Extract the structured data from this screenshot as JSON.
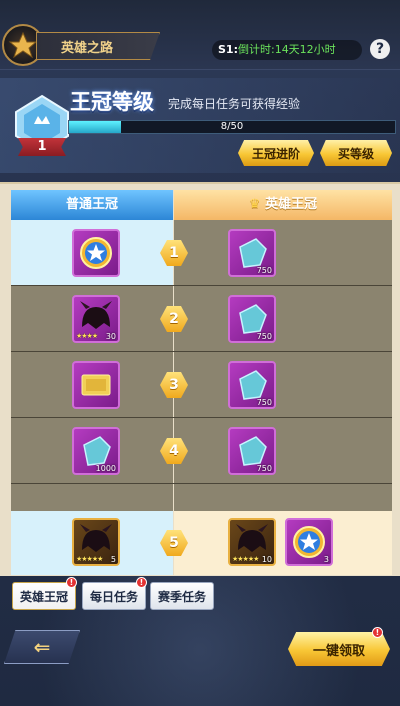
{
  "header": {
    "title": "英雄之路",
    "season_label": "S1:",
    "countdown": "倒计时:14天12小时",
    "help_label": "?"
  },
  "crown": {
    "title": "王冠等级",
    "subtitle": "完成每日任务可获得经验",
    "level": "1",
    "xp_text": "8/50",
    "xp_current": 8,
    "xp_max": 50,
    "advance_btn": "王冠进阶",
    "buy_level_btn": "买等级"
  },
  "tabs": {
    "normal": "普通王冠",
    "hero": "英雄王冠"
  },
  "rows": [
    {
      "num": "1",
      "left": {
        "icon": "blue-star-medal-icon",
        "count": "",
        "stars": ""
      },
      "right": [
        {
          "icon": "blue-crystal-icon",
          "count": "750"
        }
      ]
    },
    {
      "num": "2",
      "left": {
        "icon": "warrior-helmet-icon",
        "count": "30",
        "stars": "★★★★"
      },
      "right": [
        {
          "icon": "blue-crystal-icon",
          "count": "750"
        }
      ]
    },
    {
      "num": "3",
      "left": {
        "icon": "gold-card-icon",
        "count": "",
        "stars": ""
      },
      "right": [
        {
          "icon": "blue-crystal-icon",
          "count": "750"
        }
      ]
    },
    {
      "num": "4",
      "left": {
        "icon": "blue-crystal-icon",
        "count": "1000",
        "stars": ""
      },
      "right": [
        {
          "icon": "blue-crystal-icon",
          "count": "750"
        }
      ]
    }
  ],
  "claim_row": {
    "num": "5",
    "left": {
      "icon": "warrior-helmet-icon",
      "count": "5",
      "stars": "★★★★★"
    },
    "right": [
      {
        "icon": "warrior-helmet-icon",
        "count": "10",
        "stars": "★★★★★"
      },
      {
        "icon": "blue-star-medal-icon",
        "count": "3"
      }
    ]
  },
  "bottom_tabs": [
    {
      "label": "英雄王冠",
      "badge": "!"
    },
    {
      "label": "每日任务",
      "badge": "!"
    },
    {
      "label": "赛季任务",
      "badge": ""
    }
  ],
  "actions": {
    "back": "⇐",
    "claim_all": "一键领取",
    "claim_all_badge": "!"
  },
  "colors": {
    "accent_gold": "#f8c735",
    "normal_tab": "#2c86d6",
    "hero_tab": "#f4b766",
    "rare_purple": "#b43bc0"
  }
}
